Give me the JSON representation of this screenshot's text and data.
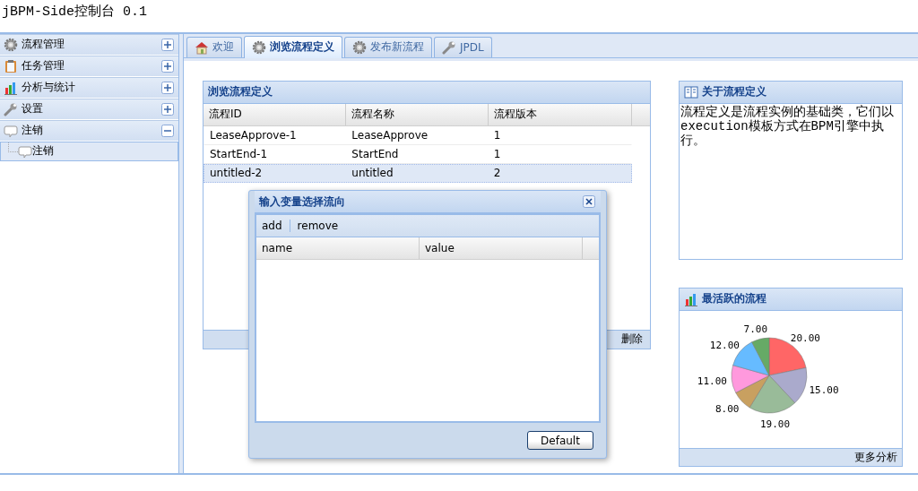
{
  "app_title": "jBPM-Side控制台 0.1",
  "sidebar": {
    "items": [
      {
        "label": "流程管理",
        "expanded": false
      },
      {
        "label": "任务管理",
        "expanded": false
      },
      {
        "label": "分析与统计",
        "expanded": false
      },
      {
        "label": "设置",
        "expanded": false
      },
      {
        "label": "注销",
        "expanded": true,
        "children": [
          {
            "label": "注销",
            "selected": true
          }
        ]
      }
    ]
  },
  "tabs": [
    {
      "label": "欢迎",
      "selected": false
    },
    {
      "label": "浏览流程定义",
      "selected": true
    },
    {
      "label": "发布新流程",
      "selected": false
    },
    {
      "label": "JPDL",
      "selected": false
    }
  ],
  "grid": {
    "title": "浏览流程定义",
    "columns": [
      "流程ID",
      "流程名称",
      "流程版本"
    ],
    "rows": [
      {
        "cells": [
          "LeaseApprove-1",
          "LeaseApprove",
          "1"
        ],
        "selected": false
      },
      {
        "cells": [
          "StartEnd-1",
          "StartEnd",
          "1"
        ],
        "selected": false
      },
      {
        "cells": [
          "untitled-2",
          "untitled",
          "2"
        ],
        "selected": true
      }
    ],
    "toolbar": [
      "删除"
    ]
  },
  "about": {
    "title": "关于流程定义",
    "text": "流程定义是流程实例的基础类，它们以execution模板方式在BPM引擎中执行。"
  },
  "chart_panel": {
    "title": "最活跃的流程",
    "chart_data": {
      "type": "pie",
      "values": [
        20,
        15,
        19,
        8,
        11,
        12,
        7
      ],
      "value_labels": [
        "20.00",
        "15.00",
        "19.00",
        "8.00",
        "11.00",
        "12.00",
        "7.00"
      ],
      "colors": [
        "#ff6666",
        "#aaaacc",
        "#99bb99",
        "#c8a060",
        "#ff99dd",
        "#66bbff",
        "#66aa66"
      ]
    },
    "footer_link": "更多分析"
  },
  "dialog": {
    "title": "输入变量选择流向",
    "toolbar": [
      "add",
      "remove"
    ],
    "columns": [
      "name",
      "value"
    ],
    "button": "Default"
  }
}
